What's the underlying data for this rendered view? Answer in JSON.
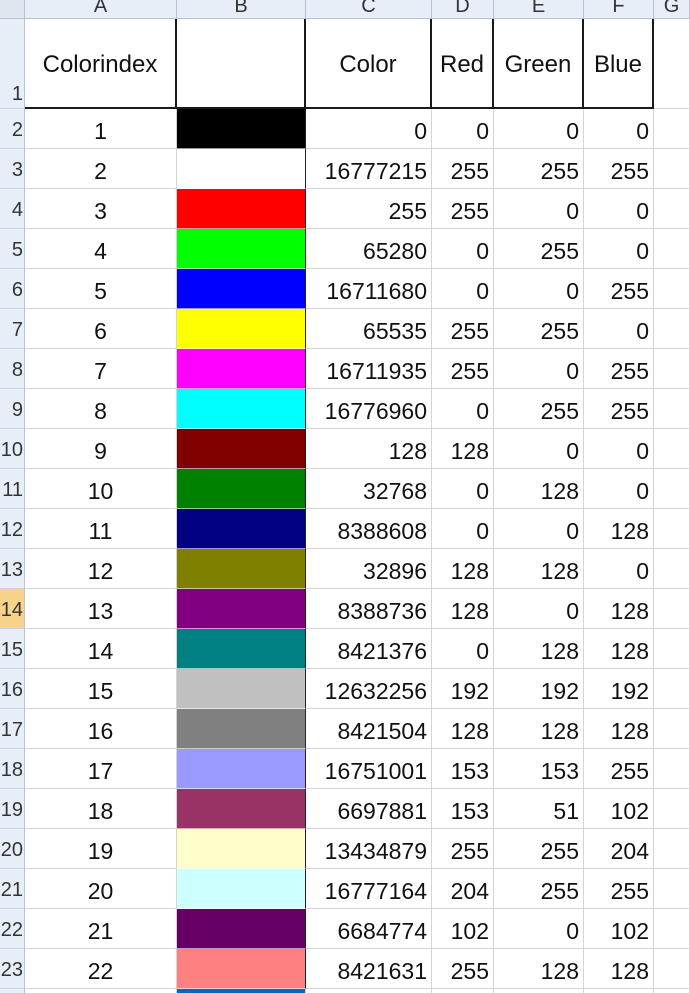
{
  "columns": [
    "A",
    "B",
    "C",
    "D",
    "E",
    "F",
    "G"
  ],
  "headers": {
    "colorindex": "Colorindex",
    "swatch": "",
    "color": "Color",
    "red": "Red",
    "green": "Green",
    "blue": "Blue"
  },
  "row_numbers": [
    "1",
    "2",
    "3",
    "4",
    "5",
    "6",
    "7",
    "8",
    "9",
    "10",
    "11",
    "12",
    "13",
    "14",
    "15",
    "16",
    "17",
    "18",
    "19",
    "20",
    "21",
    "22",
    "23"
  ],
  "active_row": "14",
  "rows": [
    {
      "index": "1",
      "swatch": "#000000",
      "color": "0",
      "red": "0",
      "green": "0",
      "blue": "0"
    },
    {
      "index": "2",
      "swatch": "#ffffff",
      "color": "16777215",
      "red": "255",
      "green": "255",
      "blue": "255"
    },
    {
      "index": "3",
      "swatch": "#ff0000",
      "color": "255",
      "red": "255",
      "green": "0",
      "blue": "0"
    },
    {
      "index": "4",
      "swatch": "#00ff00",
      "color": "65280",
      "red": "0",
      "green": "255",
      "blue": "0"
    },
    {
      "index": "5",
      "swatch": "#0000ff",
      "color": "16711680",
      "red": "0",
      "green": "0",
      "blue": "255"
    },
    {
      "index": "6",
      "swatch": "#ffff00",
      "color": "65535",
      "red": "255",
      "green": "255",
      "blue": "0"
    },
    {
      "index": "7",
      "swatch": "#ff00ff",
      "color": "16711935",
      "red": "255",
      "green": "0",
      "blue": "255"
    },
    {
      "index": "8",
      "swatch": "#00ffff",
      "color": "16776960",
      "red": "0",
      "green": "255",
      "blue": "255"
    },
    {
      "index": "9",
      "swatch": "#800000",
      "color": "128",
      "red": "128",
      "green": "0",
      "blue": "0"
    },
    {
      "index": "10",
      "swatch": "#008000",
      "color": "32768",
      "red": "0",
      "green": "128",
      "blue": "0"
    },
    {
      "index": "11",
      "swatch": "#000080",
      "color": "8388608",
      "red": "0",
      "green": "0",
      "blue": "128"
    },
    {
      "index": "12",
      "swatch": "#808000",
      "color": "32896",
      "red": "128",
      "green": "128",
      "blue": "0"
    },
    {
      "index": "13",
      "swatch": "#800080",
      "color": "8388736",
      "red": "128",
      "green": "0",
      "blue": "128"
    },
    {
      "index": "14",
      "swatch": "#008080",
      "color": "8421376",
      "red": "0",
      "green": "128",
      "blue": "128"
    },
    {
      "index": "15",
      "swatch": "#c0c0c0",
      "color": "12632256",
      "red": "192",
      "green": "192",
      "blue": "192"
    },
    {
      "index": "16",
      "swatch": "#808080",
      "color": "8421504",
      "red": "128",
      "green": "128",
      "blue": "128"
    },
    {
      "index": "17",
      "swatch": "#9999ff",
      "color": "16751001",
      "red": "153",
      "green": "153",
      "blue": "255"
    },
    {
      "index": "18",
      "swatch": "#993366",
      "color": "6697881",
      "red": "153",
      "green": "51",
      "blue": "102"
    },
    {
      "index": "19",
      "swatch": "#ffffcc",
      "color": "13434879",
      "red": "255",
      "green": "255",
      "blue": "204"
    },
    {
      "index": "20",
      "swatch": "#ccffff",
      "color": "16777164",
      "red": "204",
      "green": "255",
      "blue": "255"
    },
    {
      "index": "21",
      "swatch": "#660066",
      "color": "6684774",
      "red": "102",
      "green": "0",
      "blue": "102"
    },
    {
      "index": "22",
      "swatch": "#ff8080",
      "color": "8421631",
      "red": "255",
      "green": "128",
      "blue": "128"
    }
  ],
  "partial_next_swatch": "#0066cc"
}
